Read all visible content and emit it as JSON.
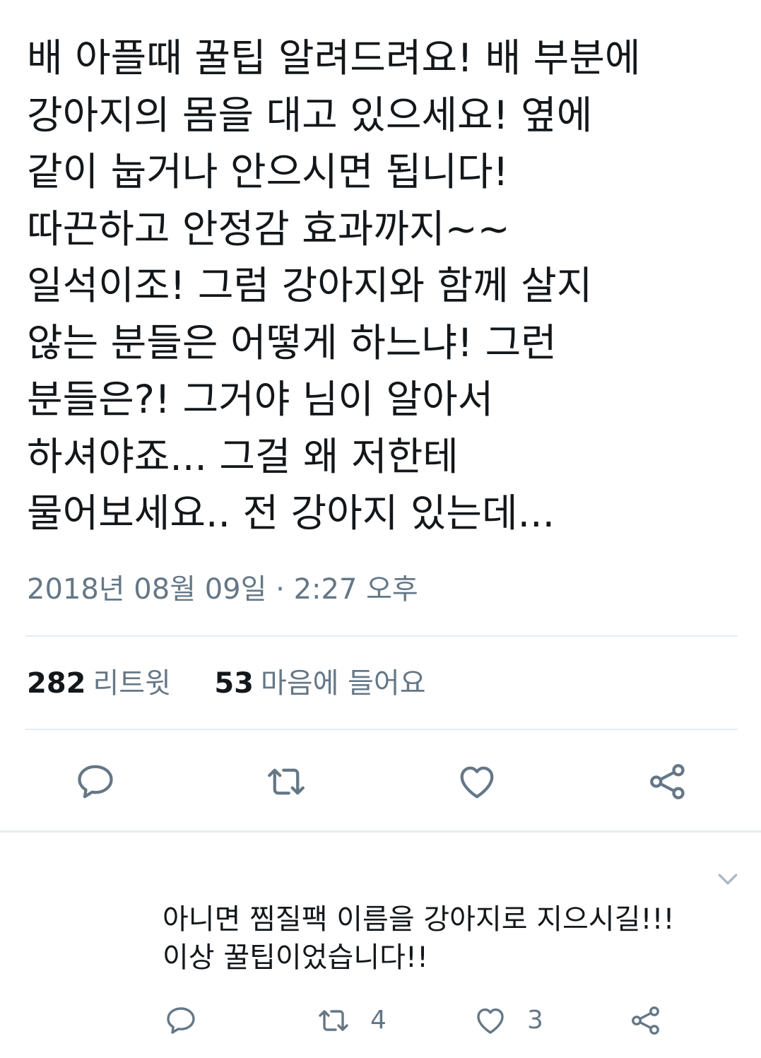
{
  "tweet": {
    "lines": [
      "배 아플때 꿀팁 알려드려요! 배 부분에",
      "강아지의 몸을 대고 있으세요! 옆에",
      "같이 눕거나 안으시면 됩니다!",
      "따끈하고 안정감 효과까지~~",
      "일석이조! 그럼 강아지와 함께 살지",
      "않는 분들은 어떻게 하느냐! 그런",
      "분들은?! 그거야 님이 알아서",
      "하셔야죠... 그걸 왜 저한테",
      "물어보세요.. 전 강아지 있는데..."
    ],
    "timestamp": "2018년 08월 09일 · 2:27 오후"
  },
  "stats": {
    "retweets_count": "282",
    "retweets_label": "리트윗",
    "likes_count": "53",
    "likes_label": "마음에 들어요"
  },
  "actions": {
    "icons": [
      "reply-icon",
      "retweet-icon",
      "like-icon",
      "share-icon"
    ],
    "icon_color": "#657786"
  },
  "reply": {
    "lines": [
      "아니면 찜질팩 이름을 강아지로 지으시길!!!",
      "이상 꿀팁이었습니다!!"
    ],
    "retweet_count": "4",
    "like_count": "3",
    "menu_icon": "chevron-down-icon"
  },
  "colors": {
    "text": "#14171a",
    "secondary": "#657786",
    "divider": "#e6ecf0"
  }
}
